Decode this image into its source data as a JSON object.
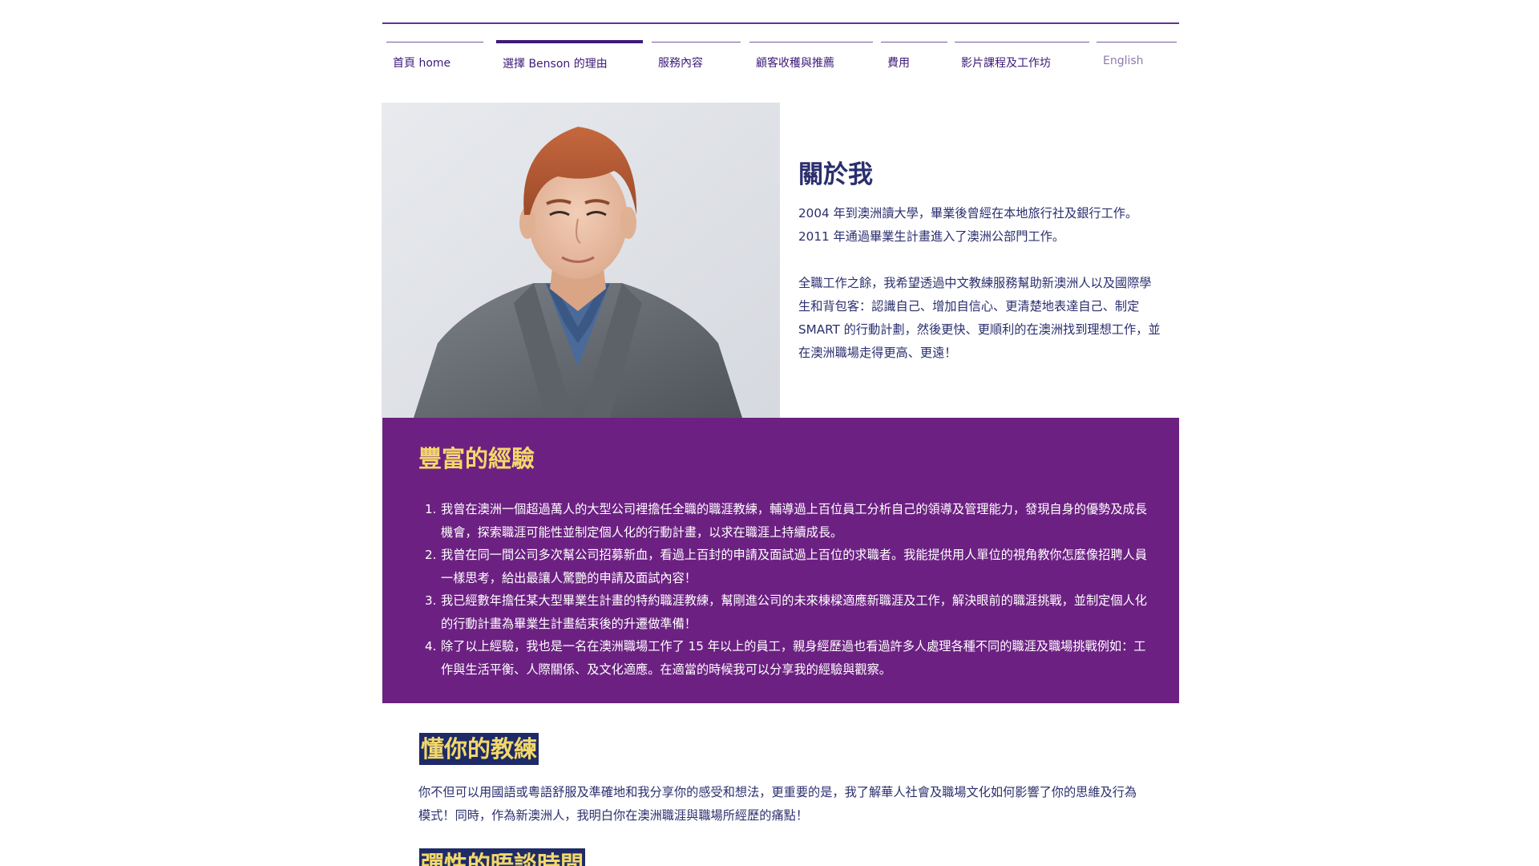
{
  "nav": {
    "items": [
      {
        "label": "首頁 home"
      },
      {
        "label": "選擇 Benson 的理由"
      },
      {
        "label": "服務內容"
      },
      {
        "label": "顧客收穫與推薦"
      },
      {
        "label": "費用"
      },
      {
        "label": "影片課程及工作坊"
      },
      {
        "label": "English"
      }
    ]
  },
  "about": {
    "title": "關於我",
    "paragraphs": [
      "2004 年到澳洲讀大學，畢業後曾經在本地旅行社及銀行工作。2011 年通過畢業生計畫進入了澳洲公部門工作。",
      "全職工作之餘，我希望透過中文教練服務幫助新澳洲人以及國際學生和背包客：認識自己、增加自信心、更清楚地表達自己、制定 SMART 的行動計劃，然後更快、更順利的在澳洲找到理想工作，並在澳洲職場走得更高、更遠！"
    ]
  },
  "experience": {
    "title": "豐富的經驗",
    "items": [
      {
        "num": "1.",
        "text": "我曾在澳洲一個超過萬人的大型公司裡擔任全職的職涯教練，輔導過上百位員工分析自己的領導及管理能力，發現自身的優勢及成長機會，探索職涯可能性並制定個人化的行動計畫，以求在職涯上持續成長。"
      },
      {
        "num": "2.",
        "text": "我曾在同一間公司多次幫公司招募新血，看過上百封的申請及面試過上百位的求職者。我能提供用人單位的視角教你怎麼像招聘人員一樣思考，給出最讓人驚艷的申請及面試內容！"
      },
      {
        "num": "3.",
        "text": "我已經數年擔任某大型畢業生計畫的特約職涯教練，幫剛進公司的未來棟樑適應新職涯及工作，解決眼前的職涯挑戰，並制定個人化的行動計畫為畢業生計畫結束後的升遷做準備！"
      },
      {
        "num": "4.",
        "text": "除了以上經驗，我也是一名在澳洲職場工作了 15 年以上的員工，親身經歷過也看過許多人處理各種不同的職涯及職場挑戰例如：工作與生活平衡、人際關係、及文化適應。在適當的時候我可以分享我的經驗與觀察。"
      }
    ]
  },
  "coach": {
    "title": "懂你的教練",
    "text": "你不但可以用國語或粵語舒服及準確地和我分享你的感受和想法，更重要的是，我了解華人社會及職場文化如何影響了你的思維及行為模式！同時，作為新澳洲人，我明白你在澳洲職涯與職場所經歷的痛點！"
  },
  "flexible": {
    "title": "彈性的晤談時間"
  },
  "colors": {
    "brand_purple": "#6c2182",
    "nav_text": "#3d1a78",
    "body_text": "#2b2f6e",
    "accent_yellow": "#f3d86a",
    "highlight_navy": "#1f2b66"
  }
}
